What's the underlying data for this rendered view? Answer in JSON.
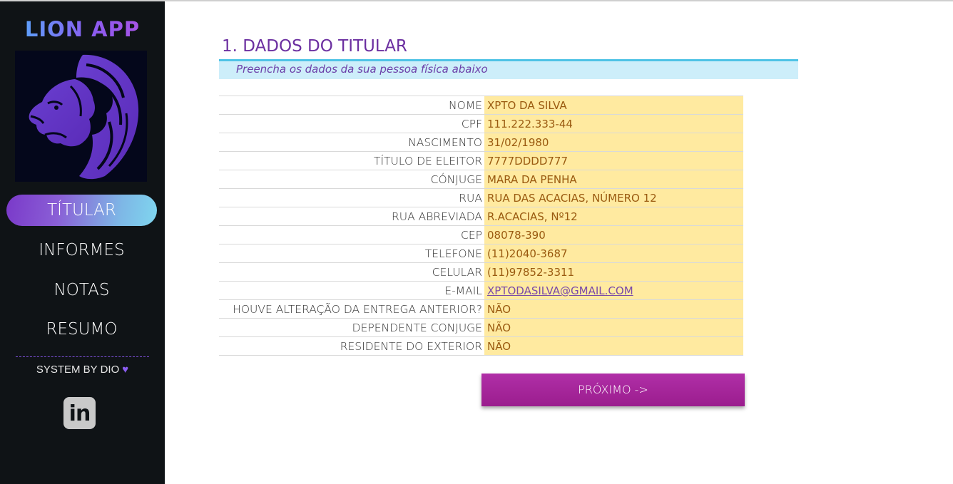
{
  "sidebar": {
    "app_title": "LION APP",
    "nav": [
      {
        "label": "TÍTULAR",
        "active": true
      },
      {
        "label": "INFORMES",
        "active": false
      },
      {
        "label": "NOTAS",
        "active": false
      },
      {
        "label": "RESUMO",
        "active": false
      }
    ],
    "byline": "SYSTEM BY DIO",
    "byline_icon": "heart-icon",
    "social_icon": "linkedin-icon",
    "social_icon_text": "in"
  },
  "main": {
    "section_title": "1. DADOS DO TITULAR",
    "subtitle": "Preencha os dados da sua pessoa física abaixo",
    "fields": [
      {
        "label": "NOME",
        "value": "XPTO DA SILVA"
      },
      {
        "label": "CPF",
        "value": "111.222.333-44"
      },
      {
        "label": "NASCIMENTO",
        "value": "31/02/1980"
      },
      {
        "label": "TÍTULO DE ELEITOR",
        "value": "7777DDDD777"
      },
      {
        "label": "CÓNJUGE",
        "value": "MARA DA PENHA"
      },
      {
        "label": "RUA",
        "value": "RUA DAS ACACIAS, NÚMERO 12"
      },
      {
        "label": "RUA ABREVIADA",
        "value": "R.ACACIAS, Nº12"
      },
      {
        "label": "CEP",
        "value": "08078-390"
      },
      {
        "label": "TELEFONE",
        "value": "(11)2040-3687"
      },
      {
        "label": "CELULAR",
        "value": "(11)97852-3311"
      },
      {
        "label": "E-MAIL",
        "value": "XPTODASILVA@GMAIL.COM"
      },
      {
        "label": "HOUVE ALTERAÇÃO DA ENTREGA ANTERIOR?",
        "value": "NÃO"
      },
      {
        "label": "DEPENDENTE CONJUGE",
        "value": "NÃO"
      },
      {
        "label": "RESIDENTE DO EXTERIOR",
        "value": "NÃO"
      }
    ],
    "next_button": "PRÓXIMO ->"
  },
  "colors": {
    "sidebar_bg": "#0f1316",
    "accent_purple": "#6b2fa0",
    "field_fill": "#ffeaa0",
    "button": "#a0208f"
  }
}
